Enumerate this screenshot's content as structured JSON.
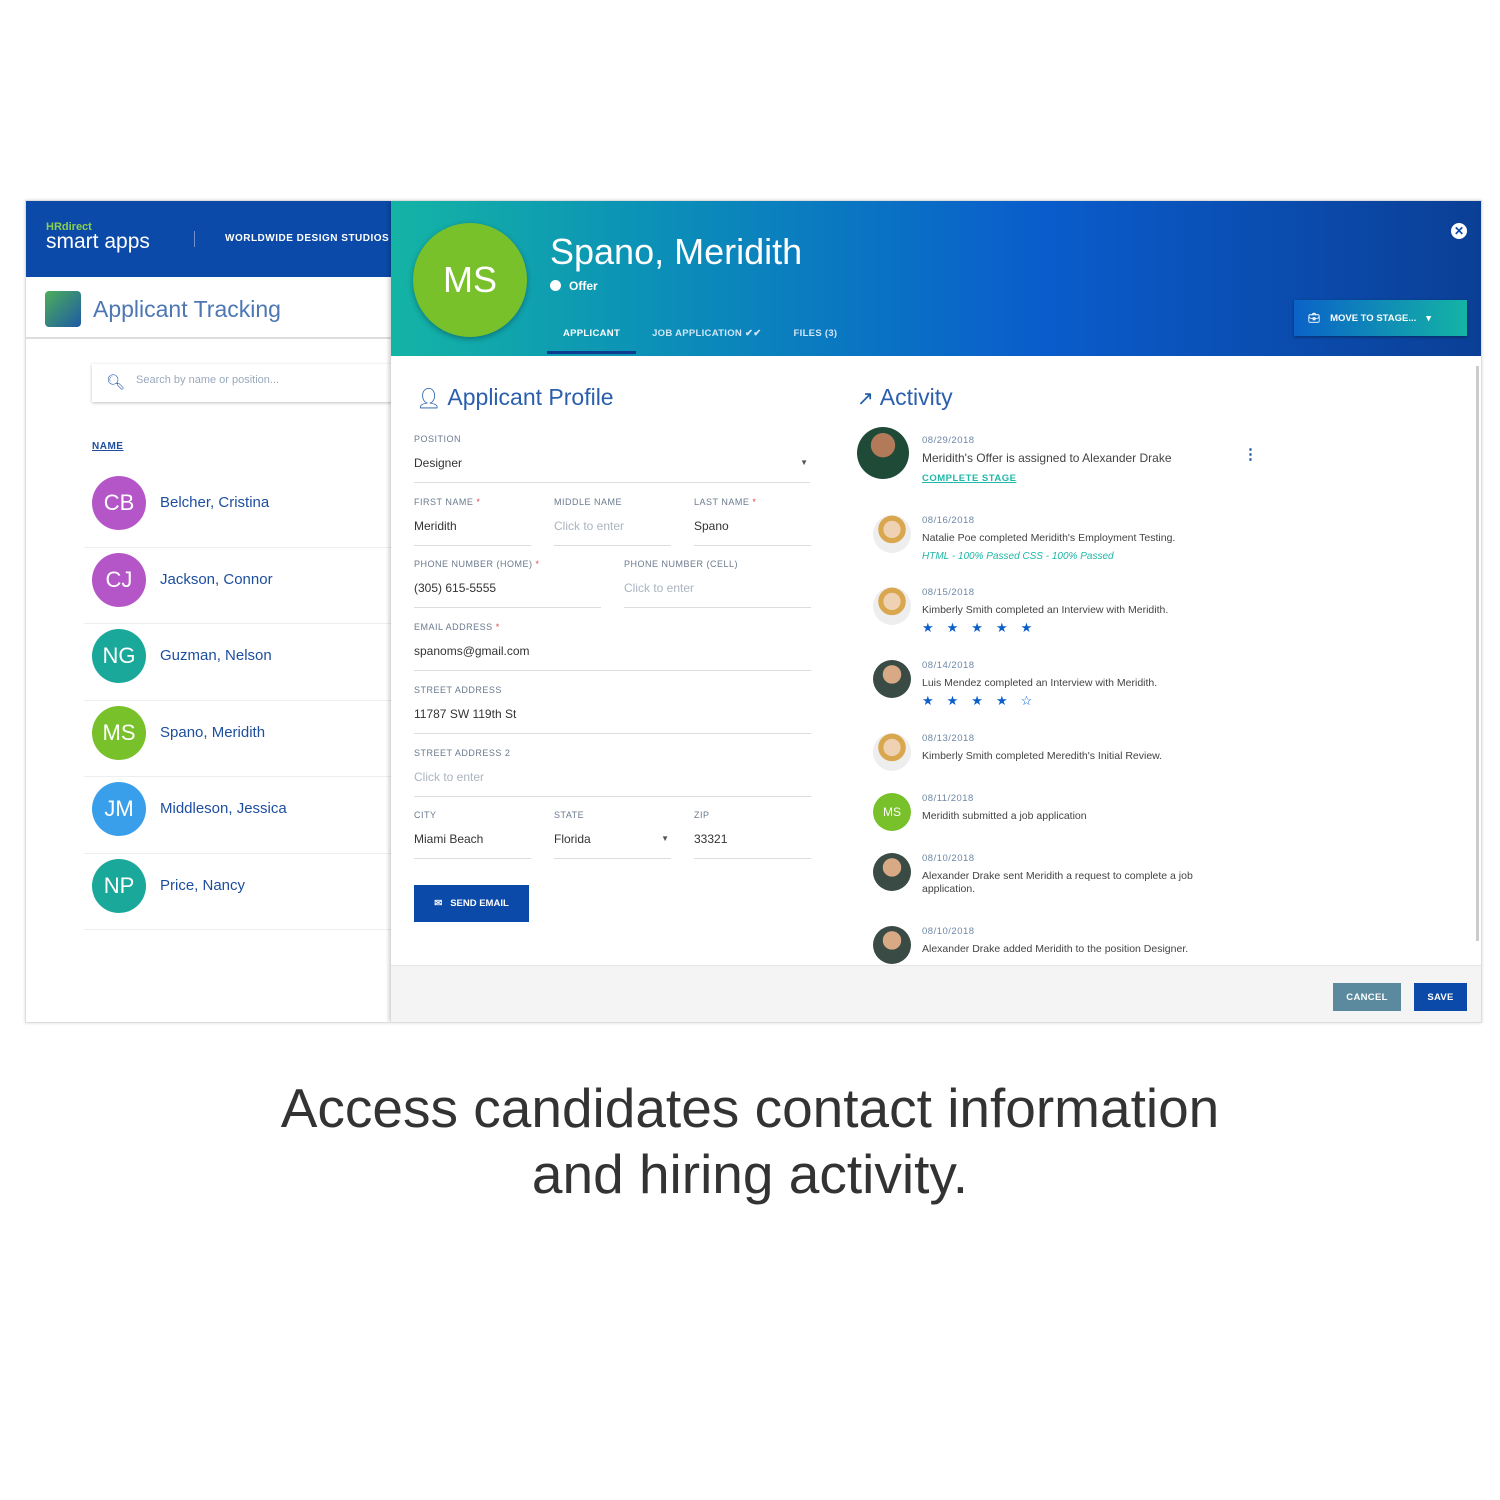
{
  "brand": {
    "logo_top": "HRdirect",
    "logo_main": "smart apps",
    "org": "WORLDWIDE DESIGN STUDIOS"
  },
  "app": {
    "title": "Applicant Tracking"
  },
  "search": {
    "placeholder": "Search by name or position..."
  },
  "list": {
    "column": "NAME",
    "items": [
      {
        "initials": "CB",
        "name": "Belcher, Cristina",
        "color": "#b556c8"
      },
      {
        "initials": "CJ",
        "name": "Jackson, Connor",
        "color": "#b556c8"
      },
      {
        "initials": "NG",
        "name": "Guzman, Nelson",
        "color": "#1aa89a"
      },
      {
        "initials": "MS",
        "name": "Spano, Meridith",
        "color": "#78c12a"
      },
      {
        "initials": "JM",
        "name": "Middleson, Jessica",
        "color": "#3a9fea"
      },
      {
        "initials": "NP",
        "name": "Price, Nancy",
        "color": "#1aa89a"
      }
    ]
  },
  "applicant": {
    "initials": "MS",
    "name": "Spano, Meridith",
    "status": "Offer",
    "tabs": [
      "APPLICANT",
      "JOB APPLICATION ✔✔",
      "FILES (3)"
    ],
    "move": "MOVE TO STAGE...",
    "close": "✕"
  },
  "profile": {
    "title": "Applicant Profile",
    "position": {
      "label": "POSITION",
      "value": "Designer"
    },
    "first": {
      "label": "FIRST NAME",
      "value": "Meridith"
    },
    "middle": {
      "label": "MIDDLE NAME",
      "placeholder": "Click to enter"
    },
    "last": {
      "label": "LAST NAME",
      "value": "Spano"
    },
    "phone_home": {
      "label": "PHONE NUMBER (HOME)",
      "value": "(305) 615-5555"
    },
    "phone_cell": {
      "label": "PHONE NUMBER (CELL)",
      "placeholder": "Click to enter"
    },
    "email": {
      "label": "EMAIL ADDRESS",
      "value": "spanoms@gmail.com"
    },
    "street": {
      "label": "STREET ADDRESS",
      "value": "11787 SW 119th St"
    },
    "street2": {
      "label": "STREET ADDRESS 2",
      "placeholder": "Click to enter"
    },
    "city": {
      "label": "CITY",
      "value": "Miami Beach"
    },
    "state": {
      "label": "STATE",
      "value": "Florida"
    },
    "zip": {
      "label": "ZIP",
      "value": "33321"
    },
    "required": "*",
    "send": "SEND EMAIL"
  },
  "activity": {
    "title": "Activity",
    "items": [
      {
        "date": "08/29/2018",
        "text": "Meridith's Offer is assigned to Alexander Drake",
        "link": "COMPLETE STAGE"
      },
      {
        "date": "08/16/2018",
        "text": "Natalie Poe completed Meridith's Employment Testing.",
        "note": "HTML - 100% Passed CSS - 100% Passed"
      },
      {
        "date": "08/15/2018",
        "text": "Kimberly Smith completed an Interview with Meridith.",
        "stars": "★★★★★",
        "rating": 5
      },
      {
        "date": "08/14/2018",
        "text": "Luis Mendez completed an Interview with Meridith.",
        "stars": "★★★★☆",
        "rating": 4
      },
      {
        "date": "08/13/2018",
        "text": "Kimberly Smith completed Meredith's Initial Review."
      },
      {
        "date": "08/11/2018",
        "text": "Meridith submitted a job application",
        "initials": "MS"
      },
      {
        "date": "08/10/2018",
        "text": "Alexander Drake sent Meridith a request to complete a job application."
      },
      {
        "date": "08/10/2018",
        "text": "Alexander Drake added Meridith to the position Designer."
      }
    ]
  },
  "footer": {
    "cancel": "CANCEL",
    "save": "SAVE"
  },
  "caption": {
    "line1": "Access candidates contact information",
    "line2": "and hiring activity."
  }
}
